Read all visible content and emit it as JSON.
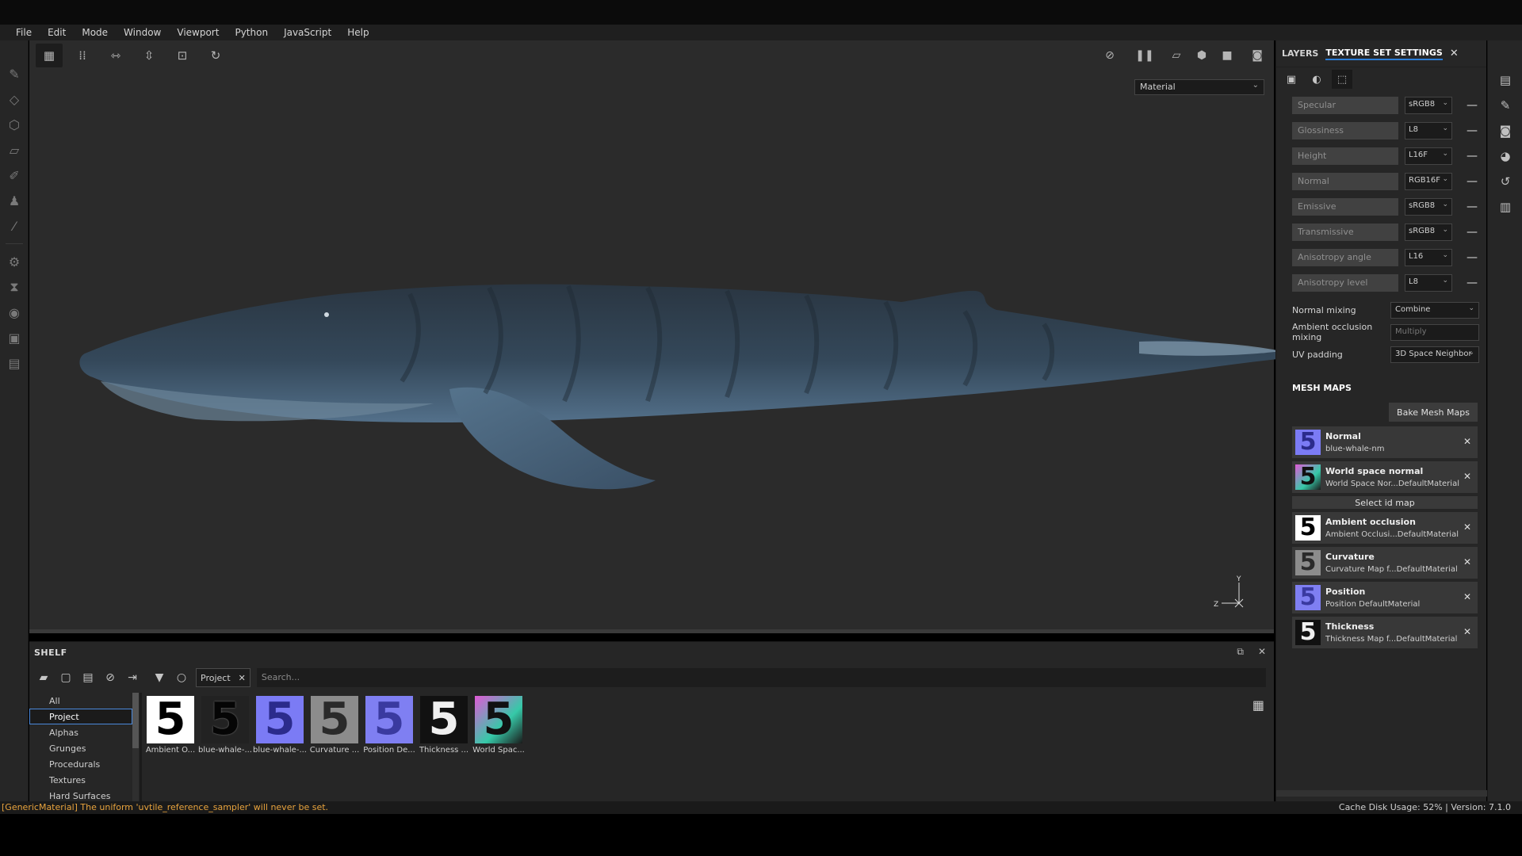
{
  "menu": [
    "File",
    "Edit",
    "Mode",
    "Window",
    "Viewport",
    "Python",
    "JavaScript",
    "Help"
  ],
  "viewport": {
    "material_select": "Material",
    "axis": {
      "y": "Y",
      "z": "Z"
    }
  },
  "shelf": {
    "title": "SHELF",
    "tag": "Project",
    "search_placeholder": "Search...",
    "categories": [
      "All",
      "Project",
      "Alphas",
      "Grunges",
      "Procedurals",
      "Textures",
      "Hard Surfaces"
    ],
    "selected_category": "Project",
    "items": [
      {
        "label": "Ambient O...",
        "color": "#ffffff"
      },
      {
        "label": "blue-whale-...",
        "color": "#222222"
      },
      {
        "label": "blue-whale-...",
        "color": "#7b7bf5"
      },
      {
        "label": "Curvature ...",
        "color": "#8c8c8c"
      },
      {
        "label": "Position De...",
        "color": "#7f7ff2"
      },
      {
        "label": "Thickness ...",
        "color": "#f0f0f0"
      },
      {
        "label": "World Spac...",
        "color": "#e05ad6"
      }
    ]
  },
  "right_panel": {
    "tabs": [
      "LAYERS",
      "TEXTURE SET SETTINGS"
    ],
    "active_tab": "TEXTURE SET SETTINGS",
    "channels": [
      {
        "name": "Specular",
        "format": "sRGB8"
      },
      {
        "name": "Glossiness",
        "format": "L8"
      },
      {
        "name": "Height",
        "format": "L16F"
      },
      {
        "name": "Normal",
        "format": "RGB16F"
      },
      {
        "name": "Emissive",
        "format": "sRGB8"
      },
      {
        "name": "Transmissive",
        "format": "sRGB8"
      },
      {
        "name": "Anisotropy angle",
        "format": "L16"
      },
      {
        "name": "Anisotropy level",
        "format": "L8"
      }
    ],
    "normal_mixing": {
      "label": "Normal mixing",
      "value": "Combine"
    },
    "ao_mixing": {
      "label": "Ambient occlusion mixing",
      "value": "Multiply"
    },
    "uv_padding": {
      "label": "UV padding",
      "value": "3D Space Neighbor"
    },
    "mesh_maps_title": "MESH MAPS",
    "bake_button": "Bake Mesh Maps",
    "select_id_map": "Select id map",
    "mesh_maps": [
      {
        "name": "Normal",
        "file": "blue-whale-nm",
        "color": "#7b7bf5"
      },
      {
        "name": "World space normal",
        "file": "World Space Nor...DefaultMaterial",
        "color": "#e05ad6"
      },
      {
        "name": "Ambient occlusion",
        "file": "Ambient Occlusi...DefaultMaterial",
        "color": "#ffffff"
      },
      {
        "name": "Curvature",
        "file": "Curvature Map f...DefaultMaterial",
        "color": "#8c8c8c"
      },
      {
        "name": "Position",
        "file": "Position DefaultMaterial",
        "color": "#7f7ff2"
      },
      {
        "name": "Thickness",
        "file": "Thickness Map f...DefaultMaterial",
        "color": "#f0f0f0"
      }
    ]
  },
  "status": {
    "message": "[GenericMaterial] The uniform 'uvtile_reference_sampler' will never be set.",
    "cache": "Cache Disk Usage:    52% | Version: 7.1.0"
  }
}
